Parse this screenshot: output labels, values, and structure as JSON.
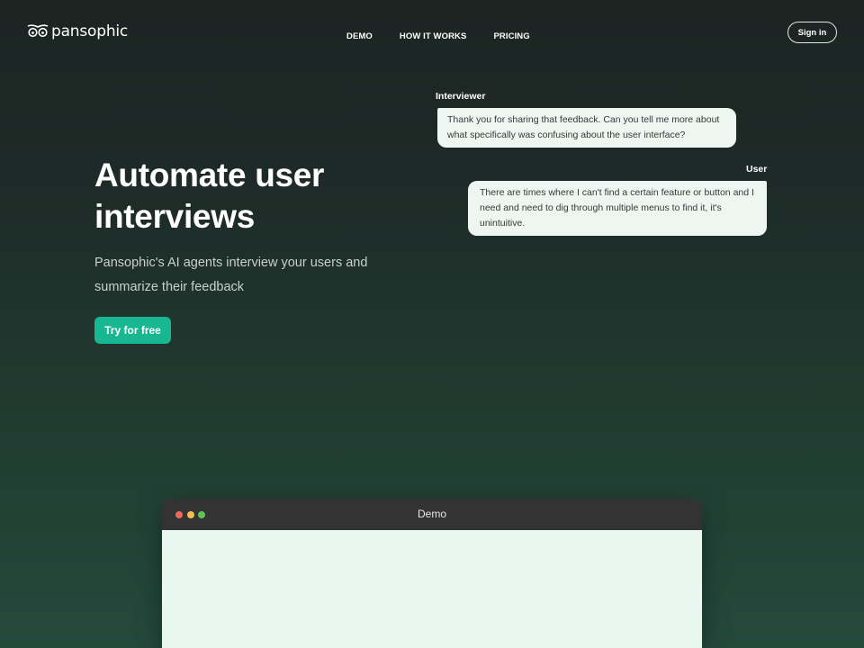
{
  "brand": {
    "logo_icon": "owl-eyes-icon",
    "name": "pansophic"
  },
  "nav": {
    "items": [
      {
        "label": "DEMO"
      },
      {
        "label": "HOW IT WORKS"
      },
      {
        "label": "PRICING"
      }
    ],
    "signin_label": "Sign in"
  },
  "hero": {
    "title": "Automate user interviews",
    "subtitle": "Pansophic's AI agents interview your users and summarize their feedback",
    "cta_label": "Try for free"
  },
  "conversation": {
    "interviewer_label": "Interviewer",
    "interviewer_message": "Thank you for sharing that feedback. Can you tell me more about what specifically was confusing about the user interface?",
    "user_label": "User",
    "user_message": "There are times where I can't find a certain feature or button and I need and need to dig through multiple menus to find it, it's unintuitive."
  },
  "demo_window": {
    "title": "Demo",
    "traffic_lights": [
      "#ec6a5e",
      "#f4bf4f",
      "#61c554"
    ]
  },
  "colors": {
    "accent": "#17b891",
    "bubble_bg": "#eef6f2",
    "demo_body_bg": "#e8f7f0",
    "window_bar": "#333333"
  }
}
